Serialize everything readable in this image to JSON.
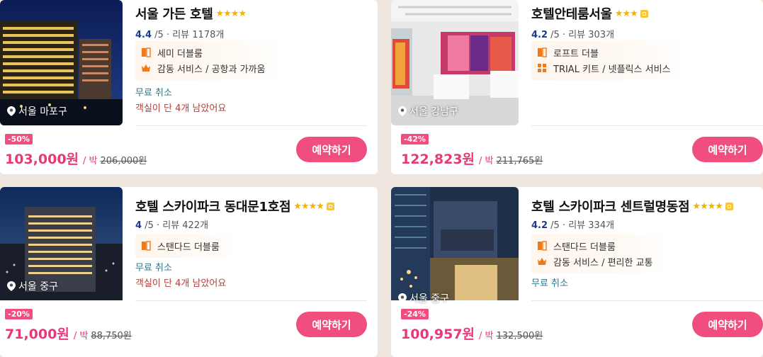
{
  "hotels": [
    {
      "name": "서울 가든 호텔",
      "stars": "★★★★",
      "score": "4.4",
      "rating_suffix": "/5 · 리뷰 1178개",
      "features": [
        "세미 더블룸",
        "감동 서비스 / 공항과 가까움"
      ],
      "feature_icons": [
        "door-icon",
        "crown-icon"
      ],
      "free_cancel": "무료 취소",
      "rooms_left": "객실이 단 4개 남았어요",
      "location": "서울 마포구",
      "discount": "-50%",
      "price": "103,000원",
      "per_night": "/ 박",
      "original_price": "206,000원",
      "book_label": "예약하기"
    },
    {
      "name": "호텔안테룸서울",
      "stars": "★★★",
      "score": "4.2",
      "rating_suffix": "/5 · 리뷰 303개",
      "features": [
        "로프트 더블",
        "TRIAL 키트 / 넷플릭스 서비스"
      ],
      "feature_icons": [
        "door-icon",
        "grid-icon"
      ],
      "location": "서울 강남구",
      "discount": "-42%",
      "price": "122,823원",
      "per_night": "/ 박",
      "original_price": "211,765원",
      "book_label": "예약하기"
    },
    {
      "name": "호텔 스카이파크 동대문1호점",
      "stars": "★★★★",
      "score": "4",
      "rating_suffix": "/5 · 리뷰 422개",
      "features": [
        "스탠다드 더블룸"
      ],
      "feature_icons": [
        "door-icon"
      ],
      "free_cancel": "무료 취소",
      "rooms_left": "객실이 단 4개 남았어요",
      "location": "서울 중구",
      "discount": "-20%",
      "price": "71,000원",
      "per_night": "/ 박",
      "original_price": "88,750원",
      "book_label": "예약하기"
    },
    {
      "name": "호텔 스카이파크 센트럴명동점",
      "stars": "★★★★",
      "score": "4.2",
      "rating_suffix": "/5 · 리뷰 334개",
      "features": [
        "스탠다드 더블룸",
        "감동 서비스 / 편리한 교통"
      ],
      "feature_icons": [
        "door-icon",
        "crown-icon"
      ],
      "free_cancel": "무료 취소",
      "location": "서울 중구",
      "discount": "-24%",
      "price": "100,957원",
      "per_night": "/ 박",
      "original_price": "132,500원",
      "book_label": "예약하기"
    }
  ],
  "colors": {
    "accent": "#f04e7e",
    "score": "#1b3a8c",
    "cancel": "#2a7a8a",
    "rooms": "#b0413e",
    "star": "#f5b301"
  }
}
